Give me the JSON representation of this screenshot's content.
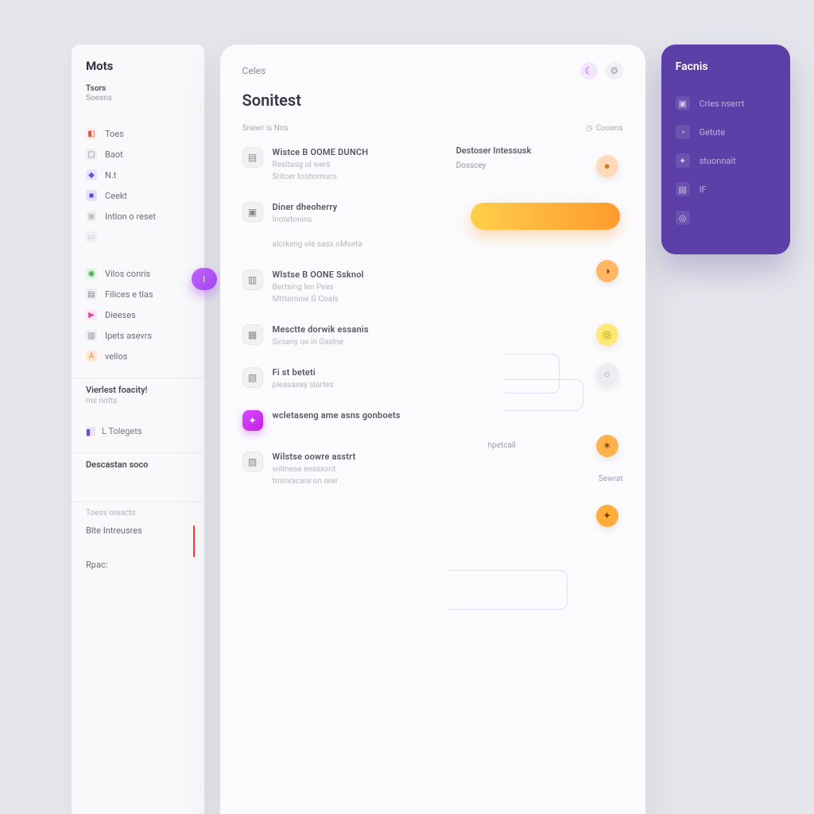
{
  "sidebar": {
    "brand": "Mots",
    "sub1": "Tsors",
    "sub2": "Soeens",
    "nav": [
      {
        "label": "Toes",
        "icon": "◧",
        "cls": "ic-red"
      },
      {
        "label": "Baot",
        "icon": "▢",
        "cls": "ic-grey"
      },
      {
        "label": "N.t",
        "icon": "◆",
        "cls": "ic-purple"
      },
      {
        "label": "Ceekt",
        "icon": "■",
        "cls": "ic-purple2"
      },
      {
        "label": "Intlon o reset",
        "icon": "▣",
        "cls": "ic-none"
      },
      {
        "label": "",
        "icon": "▭",
        "cls": "ic-none"
      }
    ],
    "nav2": [
      {
        "label": "Vilos conris",
        "icon": "◉",
        "cls": "ic-green"
      },
      {
        "label": "Filices e tlas",
        "icon": "▤",
        "cls": "ic-grey"
      },
      {
        "label": "Dieeses",
        "icon": "▶",
        "cls": "ic-pink"
      },
      {
        "label": "Ipets asevrs",
        "icon": "▥",
        "cls": "ic-grey"
      },
      {
        "label": "vellos",
        "icon": "A",
        "cls": "ic-orange"
      }
    ],
    "section3_title": "Vierlest foacity!",
    "section3_sub": "ms notts",
    "section3_item": "L Tolegets",
    "section4_title": "Descastan soco",
    "tags_title": "Toess oreacts",
    "tag1": "Blte Intreusres",
    "tag2": "Rpac:"
  },
  "main": {
    "tab": "Celes",
    "title": "Sonitest",
    "meta_left": "Snewr is Nns",
    "meta_right": "Cooens",
    "side_heading": "Destoser Intessusk",
    "side_sub": "Dosscey",
    "feed": [
      {
        "title": "Wistce B OOME DUNCH",
        "lines": [
          "Resitasg ol wers",
          "Sritcer toshomucs"
        ]
      },
      {
        "title": "Diner dheoherry",
        "lines": [
          "Inotetonins",
          "alcrkeng ole sass  oMseta"
        ]
      },
      {
        "title": "Wlstse B OONE Ssknol",
        "lines": [
          "Bertsing len Pees",
          "Mttteronie G Coals"
        ]
      },
      {
        "title": "Mesctte dorwik essanis",
        "lines": [
          "Sirseny ue in Gaslne"
        ]
      },
      {
        "title": "Fi st beteti",
        "lines": [
          "pleasaxey slartes"
        ]
      },
      {
        "title": "wcletaseng ame asns  gonboets",
        "lines": []
      },
      {
        "title": "Wilstse oowre asstrt",
        "lines": [
          "wiltnese eesexont",
          "tmmracare on orer"
        ]
      }
    ],
    "right_tags": {
      "tspecal": "hpetcall",
      "sewrat": "Sewrat"
    }
  },
  "rcard": {
    "title": "Facnis",
    "items": [
      {
        "label": "Cries nserrt",
        "icon": "▣"
      },
      {
        "label": "Getute",
        "icon": "◔"
      },
      {
        "label": "stuonnait",
        "icon": "✦"
      },
      {
        "label": "IF",
        "icon": "▤"
      },
      {
        "label": "",
        "icon": "◎"
      }
    ]
  }
}
